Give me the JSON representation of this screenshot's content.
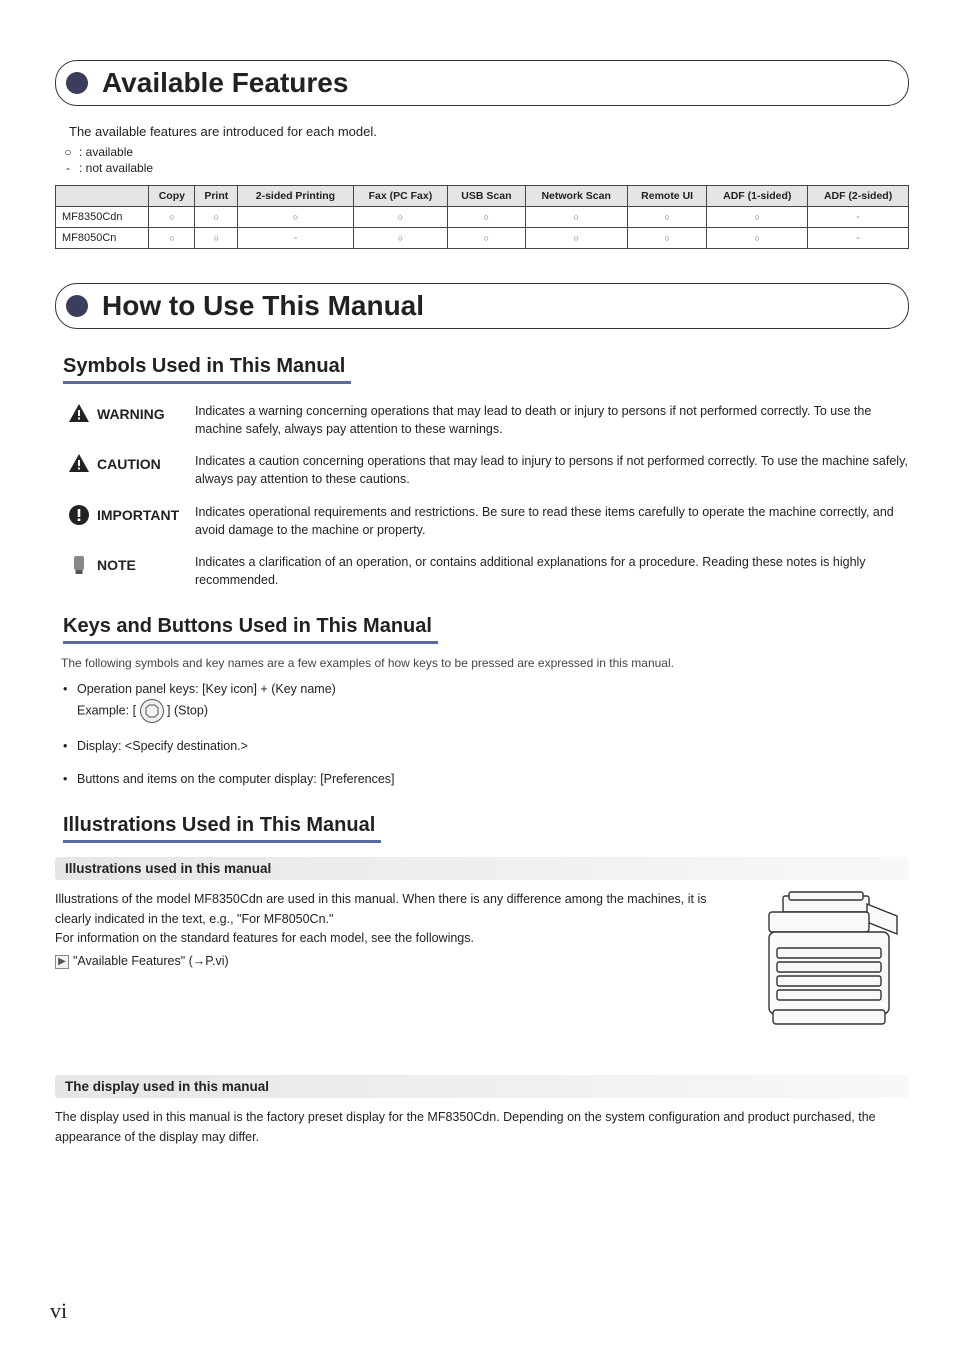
{
  "section1": {
    "title": "Available Features",
    "intro": "The available features are introduced for each model.",
    "legend_available_sym": "○",
    "legend_available_txt": ": available",
    "legend_na_sym": "-",
    "legend_na_txt": ":   not available",
    "table": {
      "headers": [
        "",
        "Copy",
        "Print",
        "2-sided Printing",
        "Fax (PC Fax)",
        "USB Scan",
        "Network Scan",
        "Remote UI",
        "ADF (1-sided)",
        "ADF (2-sided)"
      ],
      "rows": [
        {
          "model": "MF8350Cdn",
          "values": [
            "○",
            "○",
            "○",
            "○",
            "○",
            "○",
            "○",
            "○",
            "-"
          ]
        },
        {
          "model": "MF8050Cn",
          "values": [
            "○",
            "○",
            "-",
            "○",
            "○",
            "○",
            "○",
            "○",
            "-"
          ]
        }
      ]
    }
  },
  "section2": {
    "title": "How to Use This Manual",
    "sub_symbols": {
      "title": "Symbols Used in This Manual",
      "items": [
        {
          "label": "WARNING",
          "icon": "warning-icon",
          "desc": "Indicates a warning concerning operations that may lead to death or injury to persons if not performed correctly. To use the machine safely, always pay attention to these warnings."
        },
        {
          "label": "CAUTION",
          "icon": "caution-icon",
          "desc": "Indicates a caution concerning operations that may lead to injury to persons if not performed correctly. To use the machine safely, always pay attention to these cautions."
        },
        {
          "label": "IMPORTANT",
          "icon": "important-icon",
          "desc": "Indicates operational requirements and restrictions. Be sure to read these items carefully to operate the machine correctly, and avoid damage to the machine or property."
        },
        {
          "label": "NOTE",
          "icon": "note-icon",
          "desc": "Indicates a clarification of an operation, or contains additional explanations for a procedure. Reading these notes is highly recommended."
        }
      ]
    },
    "sub_keys": {
      "title": "Keys and Buttons Used in This Manual",
      "intro": "The following symbols and key names are a few examples of how keys to be pressed are expressed in this manual.",
      "items": [
        {
          "line1": "Operation panel keys: [Key icon] + (Key name)",
          "line2_prefix": "Example: [ ",
          "line2_suffix": " ] (Stop)"
        },
        {
          "line1": "Display: <Specify destination.>"
        },
        {
          "line1": "Buttons and items on the computer display: [Preferences]"
        }
      ]
    },
    "sub_illus": {
      "title": "Illustrations Used in This Manual",
      "box1_title": "Illustrations used in this manual",
      "box1_text1": "Illustrations of the model MF8350Cdn are used in this manual. When there is any difference among the machines, it is clearly indicated in the text, e.g., \"For MF8050Cn.\"",
      "box1_text2": "For information on the standard features for each model, see the followings.",
      "box1_ref": "\"Available Features\" (→P.vi)",
      "box2_title": "The display used in this manual",
      "box2_text": "The display used in this manual is the factory preset display for the MF8350Cdn. Depending on the system configuration and product purchased, the appearance of the display may differ."
    }
  },
  "page_number": "vi"
}
